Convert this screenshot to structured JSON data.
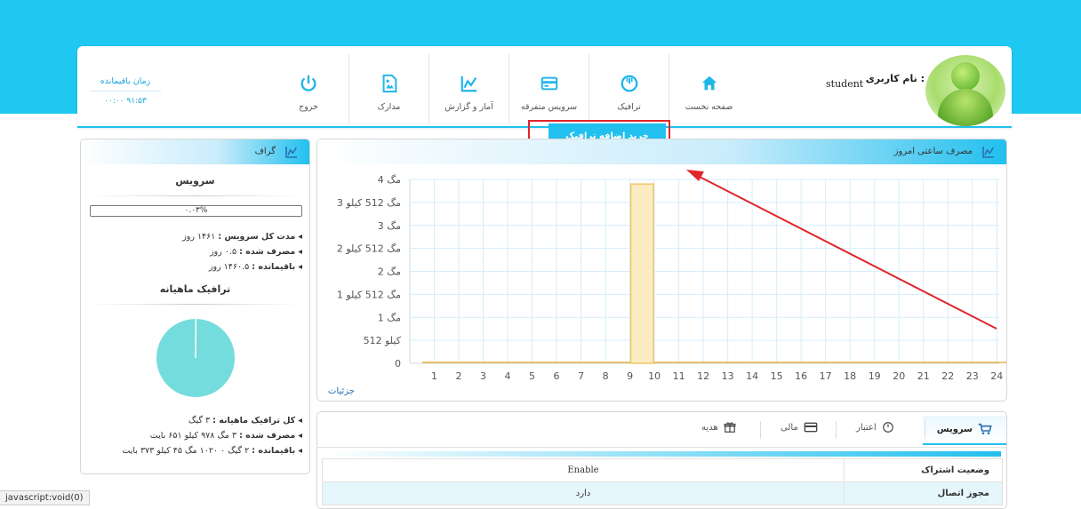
{
  "header": {
    "username_label": "نام کاربری :",
    "username": "student",
    "time_left_label": "زمان باقیمانده",
    "time_left_value": "۰۰:۰۰ ۹۱:۵۳",
    "nav": [
      {
        "label": "صفحه نخست",
        "icon": "home-icon"
      },
      {
        "label": "ترافیک",
        "icon": "gauge-icon"
      },
      {
        "label": "سرویس متفرقه",
        "icon": "card-icon"
      },
      {
        "label": "آمار و گزارش",
        "icon": "chart-icon"
      },
      {
        "label": "مدارک",
        "icon": "document-icon"
      },
      {
        "label": "خروج",
        "icon": "power-icon"
      }
    ],
    "dropdown_item": "خرید اضافه ترافیک"
  },
  "left_panel": {
    "title": "گراف",
    "service_title": "سرویس",
    "progress": "۰.۰۳%",
    "rows": [
      {
        "label": "مدت کل سرویس :",
        "value": "۱۴۶۱ روز"
      },
      {
        "label": "مصرف شده :",
        "value": "۰.۵ روز"
      },
      {
        "label": "باقیمانده :",
        "value": "۱۴۶۰.۵ روز"
      }
    ],
    "monthly_title": "ترافیک ماهیانه",
    "traffic_rows": [
      {
        "label": "کل ترافیک ماهیانه :",
        "value": "۳ گیگ"
      },
      {
        "label": "مصرف شده :",
        "value": "۳ مگ ۹۷۸ کیلو ۶۵۱ بایت"
      },
      {
        "label": "باقیمانده :",
        "value": "۲ گیگ ۰ ۱۰۲۰ مگ ۴۵ کیلو ۳۷۳ بایت"
      }
    ],
    "pie_used_fraction": 0.0013,
    "pie_color": "#74dcdc"
  },
  "chart_panel": {
    "title": "مصرف ساعتی امروز",
    "details_link": "جزئیات"
  },
  "chart_data": {
    "type": "bar",
    "categories": [
      "1",
      "2",
      "3",
      "4",
      "5",
      "6",
      "7",
      "8",
      "9",
      "10",
      "11",
      "12",
      "13",
      "14",
      "15",
      "16",
      "17",
      "18",
      "19",
      "20",
      "21",
      "22",
      "23",
      "24"
    ],
    "values": [
      0,
      0,
      0,
      0,
      0,
      0,
      0,
      0,
      3.9,
      0,
      0,
      0,
      0,
      0,
      0,
      0,
      0,
      0,
      0,
      0,
      0,
      0,
      0,
      0
    ],
    "ylim": [
      0,
      4
    ],
    "yticks": [
      {
        "v": 0,
        "label": "0"
      },
      {
        "v": 0.5,
        "label": "512 کیلو"
      },
      {
        "v": 1,
        "label": "1 مگ"
      },
      {
        "v": 1.5,
        "label": "1 مگ 512 کیلو"
      },
      {
        "v": 2,
        "label": "2 مگ"
      },
      {
        "v": 2.5,
        "label": "2 مگ 512 کیلو"
      },
      {
        "v": 3,
        "label": "3 مگ"
      },
      {
        "v": 3.5,
        "label": "3 مگ 512 کیلو"
      },
      {
        "v": 4,
        "label": "4 مگ"
      }
    ],
    "bar_color": "#fbecc2",
    "bar_border": "#f0c66a",
    "line_color": "#e8b040",
    "grid": true
  },
  "service_panel": {
    "tabs": [
      {
        "label": "سرویس",
        "icon": "cart-icon"
      },
      {
        "label": "اعتبار",
        "icon": "gauge-icon"
      },
      {
        "label": "مالی",
        "icon": "card-icon"
      },
      {
        "label": "هدیه",
        "icon": "gift-icon"
      }
    ],
    "rows": [
      {
        "key": "وضعیت اشتراک",
        "value": "Enable"
      },
      {
        "key": "مجوز اتصال",
        "value": "دارد"
      }
    ]
  },
  "statusbar": "javascript:void(0)",
  "colors": {
    "accent": "#21c0ee",
    "highlight": "#e0262c"
  }
}
